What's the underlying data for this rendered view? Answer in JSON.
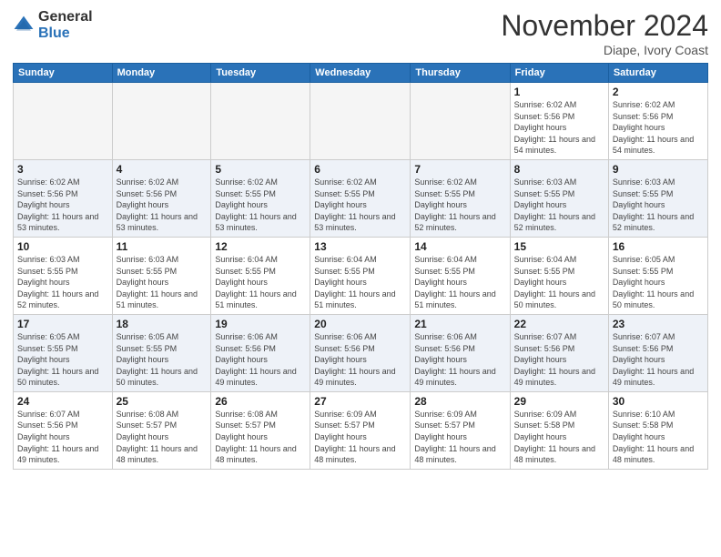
{
  "header": {
    "logo_general": "General",
    "logo_blue": "Blue",
    "month": "November 2024",
    "location": "Diape, Ivory Coast"
  },
  "days_of_week": [
    "Sunday",
    "Monday",
    "Tuesday",
    "Wednesday",
    "Thursday",
    "Friday",
    "Saturday"
  ],
  "weeks": [
    [
      {
        "day": "",
        "empty": true
      },
      {
        "day": "",
        "empty": true
      },
      {
        "day": "",
        "empty": true
      },
      {
        "day": "",
        "empty": true
      },
      {
        "day": "",
        "empty": true
      },
      {
        "day": "1",
        "sunrise": "Sunrise: 6:02 AM",
        "sunset": "Sunset: 5:56 PM",
        "daylight": "Daylight: 11 hours and 54 minutes."
      },
      {
        "day": "2",
        "sunrise": "Sunrise: 6:02 AM",
        "sunset": "Sunset: 5:56 PM",
        "daylight": "Daylight: 11 hours and 54 minutes."
      }
    ],
    [
      {
        "day": "3",
        "sunrise": "Sunrise: 6:02 AM",
        "sunset": "Sunset: 5:56 PM",
        "daylight": "Daylight: 11 hours and 53 minutes."
      },
      {
        "day": "4",
        "sunrise": "Sunrise: 6:02 AM",
        "sunset": "Sunset: 5:56 PM",
        "daylight": "Daylight: 11 hours and 53 minutes."
      },
      {
        "day": "5",
        "sunrise": "Sunrise: 6:02 AM",
        "sunset": "Sunset: 5:55 PM",
        "daylight": "Daylight: 11 hours and 53 minutes."
      },
      {
        "day": "6",
        "sunrise": "Sunrise: 6:02 AM",
        "sunset": "Sunset: 5:55 PM",
        "daylight": "Daylight: 11 hours and 53 minutes."
      },
      {
        "day": "7",
        "sunrise": "Sunrise: 6:02 AM",
        "sunset": "Sunset: 5:55 PM",
        "daylight": "Daylight: 11 hours and 52 minutes."
      },
      {
        "day": "8",
        "sunrise": "Sunrise: 6:03 AM",
        "sunset": "Sunset: 5:55 PM",
        "daylight": "Daylight: 11 hours and 52 minutes."
      },
      {
        "day": "9",
        "sunrise": "Sunrise: 6:03 AM",
        "sunset": "Sunset: 5:55 PM",
        "daylight": "Daylight: 11 hours and 52 minutes."
      }
    ],
    [
      {
        "day": "10",
        "sunrise": "Sunrise: 6:03 AM",
        "sunset": "Sunset: 5:55 PM",
        "daylight": "Daylight: 11 hours and 52 minutes."
      },
      {
        "day": "11",
        "sunrise": "Sunrise: 6:03 AM",
        "sunset": "Sunset: 5:55 PM",
        "daylight": "Daylight: 11 hours and 51 minutes."
      },
      {
        "day": "12",
        "sunrise": "Sunrise: 6:04 AM",
        "sunset": "Sunset: 5:55 PM",
        "daylight": "Daylight: 11 hours and 51 minutes."
      },
      {
        "day": "13",
        "sunrise": "Sunrise: 6:04 AM",
        "sunset": "Sunset: 5:55 PM",
        "daylight": "Daylight: 11 hours and 51 minutes."
      },
      {
        "day": "14",
        "sunrise": "Sunrise: 6:04 AM",
        "sunset": "Sunset: 5:55 PM",
        "daylight": "Daylight: 11 hours and 51 minutes."
      },
      {
        "day": "15",
        "sunrise": "Sunrise: 6:04 AM",
        "sunset": "Sunset: 5:55 PM",
        "daylight": "Daylight: 11 hours and 50 minutes."
      },
      {
        "day": "16",
        "sunrise": "Sunrise: 6:05 AM",
        "sunset": "Sunset: 5:55 PM",
        "daylight": "Daylight: 11 hours and 50 minutes."
      }
    ],
    [
      {
        "day": "17",
        "sunrise": "Sunrise: 6:05 AM",
        "sunset": "Sunset: 5:55 PM",
        "daylight": "Daylight: 11 hours and 50 minutes."
      },
      {
        "day": "18",
        "sunrise": "Sunrise: 6:05 AM",
        "sunset": "Sunset: 5:55 PM",
        "daylight": "Daylight: 11 hours and 50 minutes."
      },
      {
        "day": "19",
        "sunrise": "Sunrise: 6:06 AM",
        "sunset": "Sunset: 5:56 PM",
        "daylight": "Daylight: 11 hours and 49 minutes."
      },
      {
        "day": "20",
        "sunrise": "Sunrise: 6:06 AM",
        "sunset": "Sunset: 5:56 PM",
        "daylight": "Daylight: 11 hours and 49 minutes."
      },
      {
        "day": "21",
        "sunrise": "Sunrise: 6:06 AM",
        "sunset": "Sunset: 5:56 PM",
        "daylight": "Daylight: 11 hours and 49 minutes."
      },
      {
        "day": "22",
        "sunrise": "Sunrise: 6:07 AM",
        "sunset": "Sunset: 5:56 PM",
        "daylight": "Daylight: 11 hours and 49 minutes."
      },
      {
        "day": "23",
        "sunrise": "Sunrise: 6:07 AM",
        "sunset": "Sunset: 5:56 PM",
        "daylight": "Daylight: 11 hours and 49 minutes."
      }
    ],
    [
      {
        "day": "24",
        "sunrise": "Sunrise: 6:07 AM",
        "sunset": "Sunset: 5:56 PM",
        "daylight": "Daylight: 11 hours and 49 minutes."
      },
      {
        "day": "25",
        "sunrise": "Sunrise: 6:08 AM",
        "sunset": "Sunset: 5:57 PM",
        "daylight": "Daylight: 11 hours and 48 minutes."
      },
      {
        "day": "26",
        "sunrise": "Sunrise: 6:08 AM",
        "sunset": "Sunset: 5:57 PM",
        "daylight": "Daylight: 11 hours and 48 minutes."
      },
      {
        "day": "27",
        "sunrise": "Sunrise: 6:09 AM",
        "sunset": "Sunset: 5:57 PM",
        "daylight": "Daylight: 11 hours and 48 minutes."
      },
      {
        "day": "28",
        "sunrise": "Sunrise: 6:09 AM",
        "sunset": "Sunset: 5:57 PM",
        "daylight": "Daylight: 11 hours and 48 minutes."
      },
      {
        "day": "29",
        "sunrise": "Sunrise: 6:09 AM",
        "sunset": "Sunset: 5:58 PM",
        "daylight": "Daylight: 11 hours and 48 minutes."
      },
      {
        "day": "30",
        "sunrise": "Sunrise: 6:10 AM",
        "sunset": "Sunset: 5:58 PM",
        "daylight": "Daylight: 11 hours and 48 minutes."
      }
    ]
  ]
}
